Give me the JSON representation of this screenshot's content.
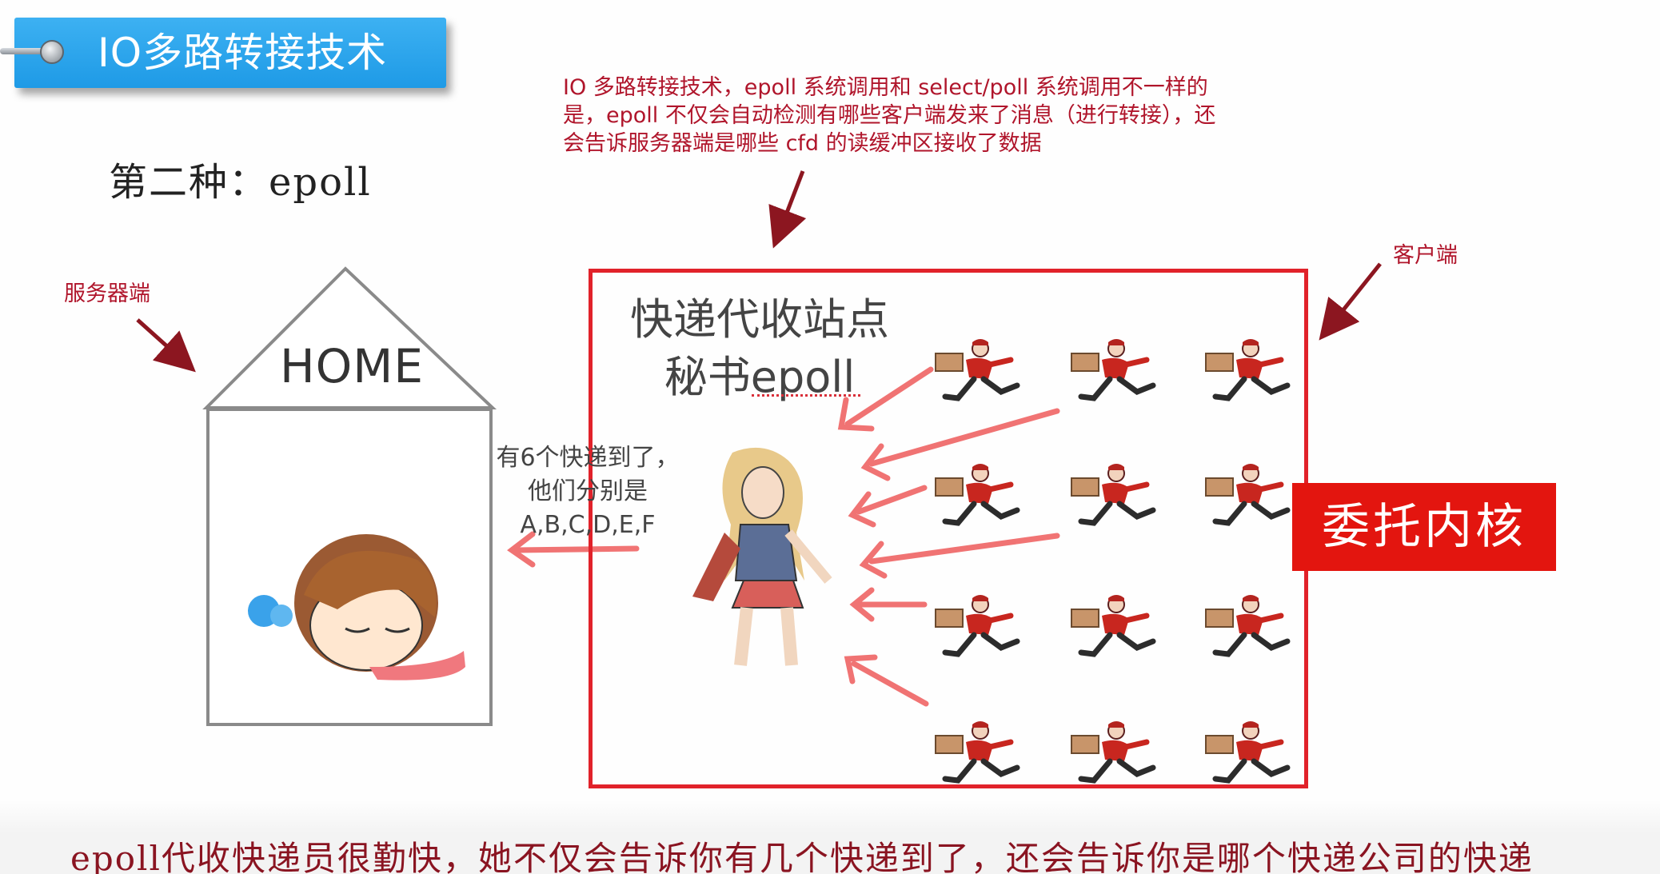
{
  "slide": {
    "title": "IO多路转接技术",
    "scheme_heading": "第二种：epoll"
  },
  "annotations": {
    "top_note": "IO 多路转接技术，epoll 系统调用和 select/poll 系统调用不一样的是，epoll 不仅会自动检测有哪些客户端发来了消息（进行转接），还会告诉服务器端是哪些 cfd 的读缓冲区接收了数据",
    "server_label": "服务器端",
    "client_label": "客户端"
  },
  "house": {
    "label": "HOME"
  },
  "station": {
    "title_line1": "快递代收站点",
    "title_line2": "秘书epoll",
    "speech_line1": "有6个快递到了，",
    "speech_line2": "他们分别是",
    "speech_line3": "A,B,C,D,E,F"
  },
  "kernel_badge": "委托内核",
  "subtitle": "epoll代收快递员很勤快，她不仅会告诉你有几个快递到了，还会告诉你是哪个快递公司的快递",
  "colors": {
    "annotation_red": "#b0152b",
    "box_red": "#e1222a",
    "banner_blue": "#1e9ae6",
    "kernel_red": "#e3150f",
    "sketch_arrow": "#ee5a5a"
  },
  "icons": [
    "pushpin-icon",
    "sleeping-girl-illustration",
    "superhero-secretary-illustration",
    "courier-runner-icon"
  ]
}
